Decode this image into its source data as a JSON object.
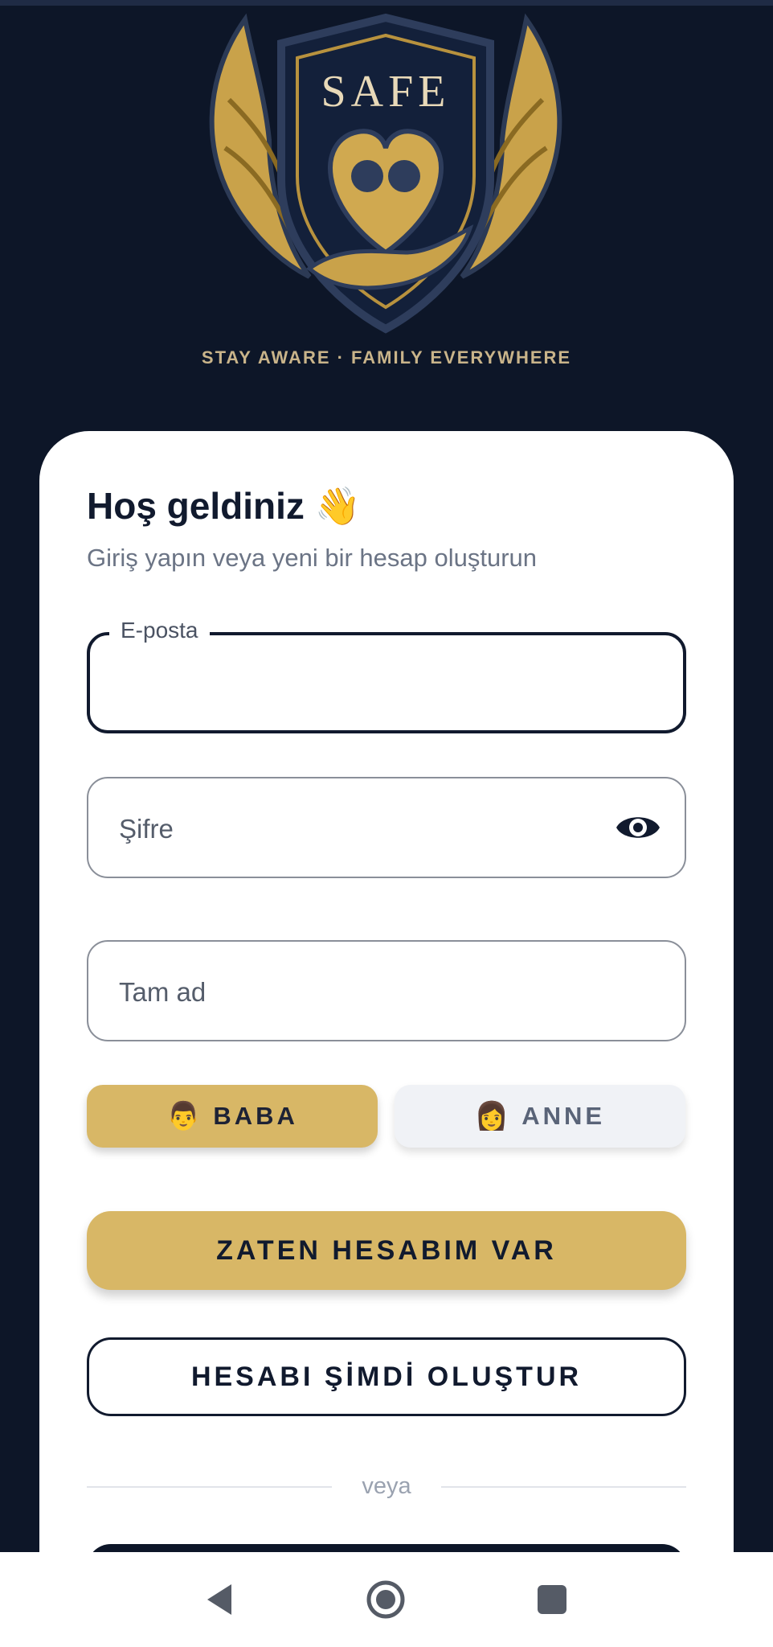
{
  "branding": {
    "logo_text": "SAFE",
    "tagline": "STAY AWARE · FAMILY EVERYWHERE"
  },
  "welcome": {
    "title": "Hoş geldiniz 👋",
    "subtitle": "Giriş yapın veya yeni bir hesap oluşturun"
  },
  "form": {
    "email_label": "E-posta",
    "email_value": "",
    "password_placeholder": "Şifre",
    "fullname_placeholder": "Tam ad"
  },
  "roles": {
    "father_emoji": "👨",
    "father_label": "BABA",
    "mother_emoji": "👩",
    "mother_label": "ANNE",
    "selected": "BABA"
  },
  "actions": {
    "login_label": "ZATEN HESABIM VAR",
    "register_label": "HESABI ŞİMDİ OLUŞTUR",
    "divider_label": "veya"
  },
  "icons": {
    "password_toggle": "eye-icon",
    "nav_back": "back-triangle-icon",
    "nav_home": "home-circle-icon",
    "nav_recents": "recents-square-icon"
  },
  "colors": {
    "background": "#0d1628",
    "accent_gold": "#d8b766",
    "card": "#ffffff",
    "text_dark": "#111a2e"
  }
}
